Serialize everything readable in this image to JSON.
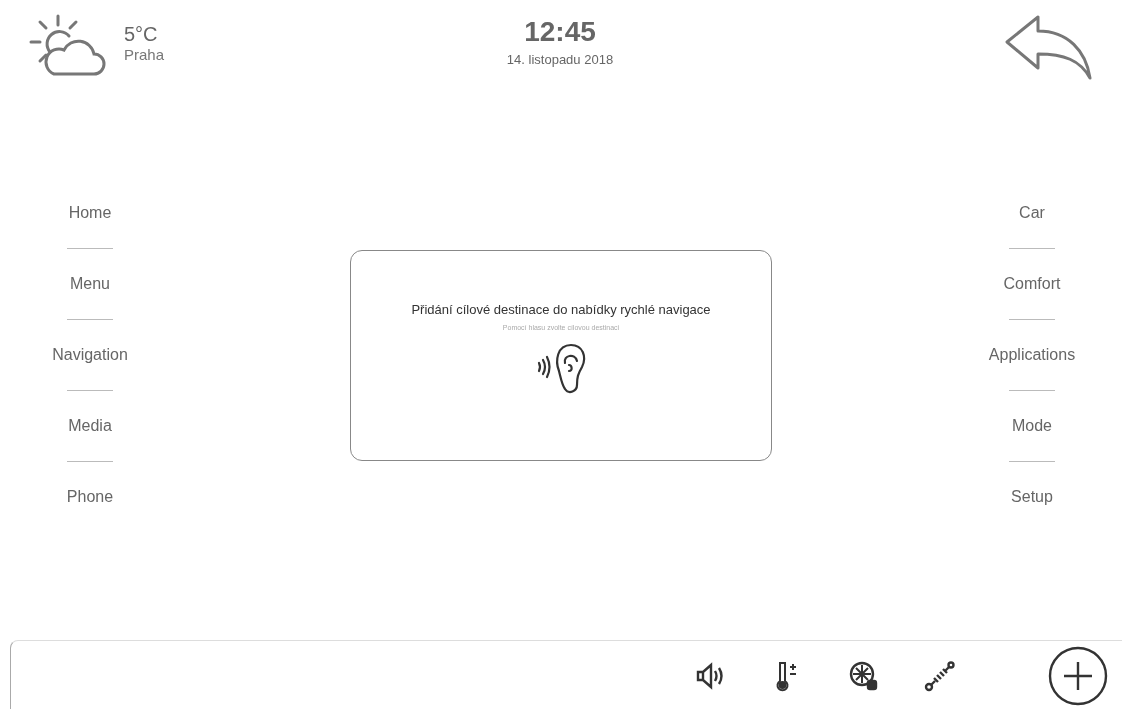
{
  "weather": {
    "temperature": "5°C",
    "city": "Praha"
  },
  "clock": {
    "time": "12:45",
    "date": "14. listopadu 2018"
  },
  "left_menu": [
    "Home",
    "Menu",
    "Navigation",
    "Media",
    "Phone"
  ],
  "right_menu": [
    "Car",
    "Comfort",
    "Applications",
    "Mode",
    "Setup"
  ],
  "dialog": {
    "title": "Přidání cílové destinace do nabídky rychlé navigace",
    "subtitle": "Pomocí hlasu zvolte cílovou destinaci"
  },
  "dock": [
    {
      "kind": "speaker"
    },
    {
      "kind": "thermometer"
    },
    {
      "kind": "fan"
    },
    {
      "kind": "spring"
    }
  ]
}
